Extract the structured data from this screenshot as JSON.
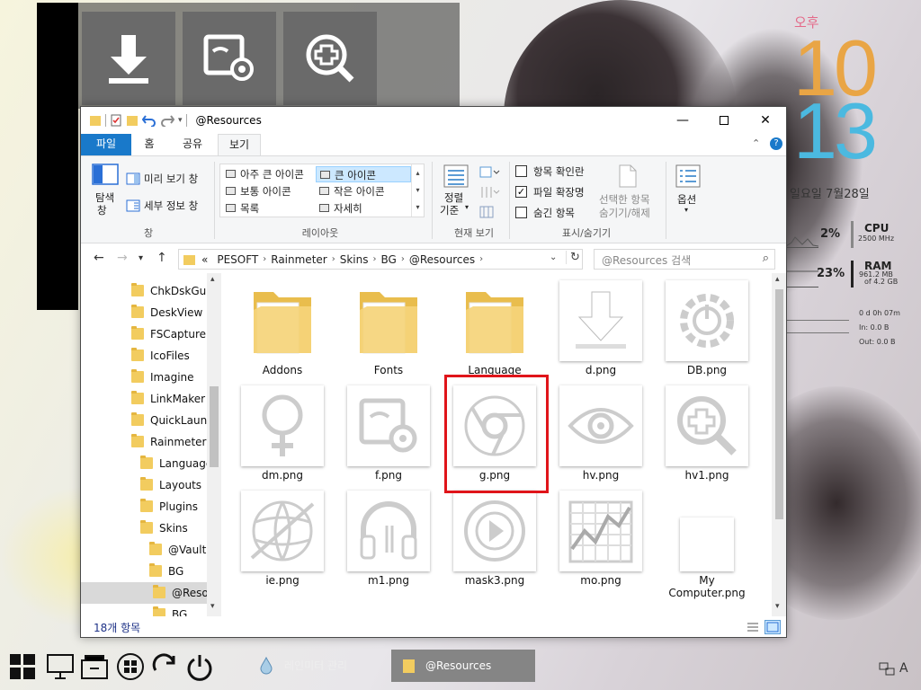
{
  "colors": {
    "accent": "#1979ca",
    "highlight_box": "#e0141a",
    "clock_hour": "#e9a545",
    "clock_minute": "#4bb9e0",
    "ampm": "#e46a8a"
  },
  "desktop": {
    "launcher": {
      "icons": [
        "download-icon",
        "image-gear-icon",
        "magnifier-plus-icon"
      ]
    },
    "clock": {
      "ampm": "오후",
      "hour": "10",
      "minute": "13",
      "date": "일요일 7월28일"
    },
    "sysmon": {
      "cpu_percent": "2%",
      "cpu_label": "CPU",
      "cpu_speed": "2500 MHz",
      "ram_percent": "23%",
      "ram_label": "RAM",
      "ram_used": "961.2 MB",
      "ram_total": "of  4.2 GB",
      "uptime": "0 d 0h 07m",
      "net_in": "In: 0.0 B",
      "net_out": "Out: 0.0 B"
    }
  },
  "explorer": {
    "title": "@Resources",
    "window_buttons": [
      "minimize-icon",
      "maximize-icon",
      "close-icon"
    ],
    "ribbon_tabs": [
      {
        "label": "파일"
      },
      {
        "label": "홈"
      },
      {
        "label": "공유"
      },
      {
        "label": "보기"
      }
    ],
    "active_tab": "보기",
    "ribbon": {
      "pane_nav_line1": "탐색",
      "pane_nav_line2": "창",
      "preview_pane": "미리 보기 창",
      "details_pane": "세부 정보 창",
      "pane_group": "창",
      "layout_options": [
        {
          "label": "아주 큰 아이콘",
          "selected": false
        },
        {
          "label": "큰 아이콘",
          "selected": true
        },
        {
          "label": "보통 아이콘",
          "selected": false
        },
        {
          "label": "작은 아이콘",
          "selected": false
        },
        {
          "label": "목록",
          "selected": false
        },
        {
          "label": "자세히",
          "selected": false
        }
      ],
      "layout_group": "레이아웃",
      "sort_line1": "정렬",
      "sort_line2": "기준",
      "current_view_group": "현재 보기",
      "item_checkboxes": "항목 확인란",
      "file_extensions": "파일 확장명",
      "hidden_items": "숨긴 항목",
      "item_checkboxes_checked": false,
      "file_extensions_checked": true,
      "hidden_items_checked": false,
      "hide_selected_line1": "선택한 항목",
      "hide_selected_line2": "숨기기/해제",
      "showhide_group": "표시/숨기기",
      "options": "옵션"
    },
    "address": {
      "crumbs": [
        "PESOFT",
        "Rainmeter",
        "Skins",
        "BG",
        "@Resources"
      ],
      "overflow": "«",
      "search_placeholder": "@Resources 검색"
    },
    "nav_tree": [
      {
        "label": "ChkDskGui",
        "indent": 0
      },
      {
        "label": "DeskView",
        "indent": 0
      },
      {
        "label": "FSCapture",
        "indent": 0
      },
      {
        "label": "IcoFiles",
        "indent": 0
      },
      {
        "label": "Imagine",
        "indent": 0
      },
      {
        "label": "LinkMaker",
        "indent": 0
      },
      {
        "label": "QuickLaunch",
        "indent": 0
      },
      {
        "label": "Rainmeter",
        "indent": 0
      },
      {
        "label": "Languages",
        "indent": 1
      },
      {
        "label": "Layouts",
        "indent": 1
      },
      {
        "label": "Plugins",
        "indent": 1
      },
      {
        "label": "Skins",
        "indent": 1
      },
      {
        "label": "@Vault",
        "indent": 2
      },
      {
        "label": "BG",
        "indent": 2
      },
      {
        "label": "@Resources",
        "indent": 3,
        "selected": true
      },
      {
        "label": "BG",
        "indent": 3
      }
    ],
    "files": [
      {
        "name": "Addons",
        "kind": "folder"
      },
      {
        "name": "Fonts",
        "kind": "folder"
      },
      {
        "name": "Language",
        "kind": "folder"
      },
      {
        "name": "d.png",
        "kind": "image",
        "icon": "download-icon"
      },
      {
        "name": "DB.png",
        "kind": "image",
        "icon": "power-gear-icon"
      },
      {
        "name": "dm.png",
        "kind": "image",
        "icon": "female-symbol-icon"
      },
      {
        "name": "f.png",
        "kind": "image",
        "icon": "image-gear-icon"
      },
      {
        "name": "g.png",
        "kind": "image",
        "icon": "chrome-icon"
      },
      {
        "name": "hv.png",
        "kind": "image",
        "icon": "eye-icon"
      },
      {
        "name": "hv1.png",
        "kind": "image",
        "icon": "magnifier-plus-icon"
      },
      {
        "name": "ie.png",
        "kind": "image",
        "icon": "globe-icon"
      },
      {
        "name": "m1.png",
        "kind": "image",
        "icon": "headphones-icon"
      },
      {
        "name": "mask3.png",
        "kind": "image",
        "icon": "play-circle-icon"
      },
      {
        "name": "mo.png",
        "kind": "image",
        "icon": "stock-chart-icon"
      },
      {
        "name": "My Computer.png",
        "kind": "image",
        "icon": "blank-icon"
      }
    ],
    "status_count": "18개 항목"
  },
  "taskbar": {
    "icons": [
      "windows-tiles-icon",
      "monitor-icon",
      "file-drawer-icon",
      "windows-logo-icon",
      "refresh-icon",
      "power-icon"
    ],
    "tasks": [
      {
        "label": "레인미터 관리",
        "icon": "water-drop-icon",
        "active": false
      },
      {
        "label": "@Resources",
        "icon": "folder-icon",
        "active": true
      }
    ]
  }
}
